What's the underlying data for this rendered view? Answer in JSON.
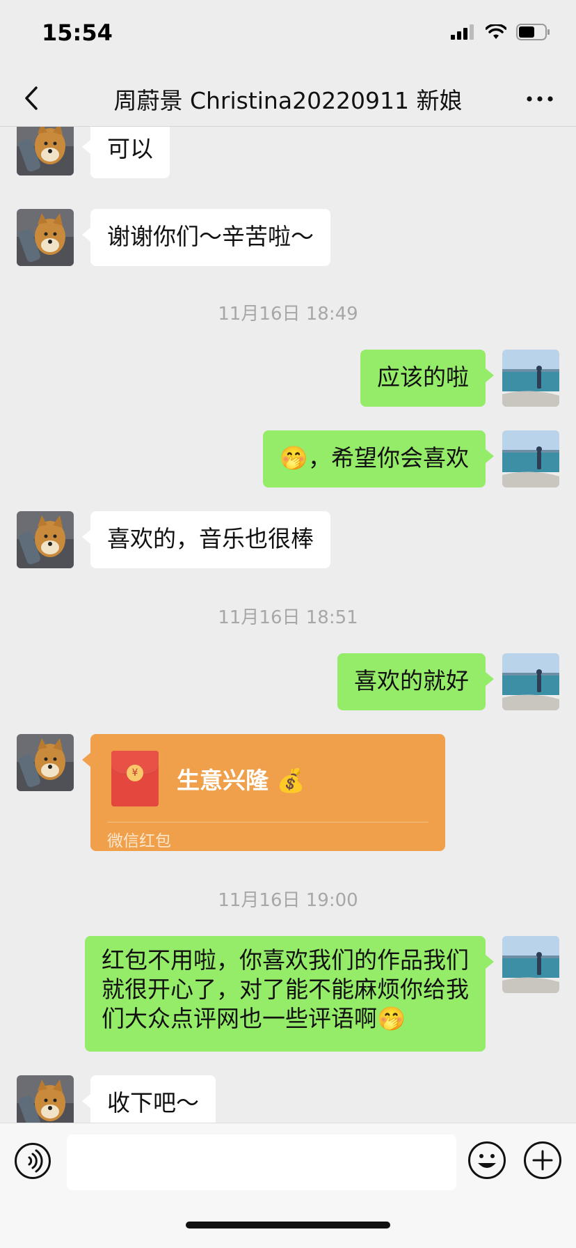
{
  "status": {
    "time": "15:54"
  },
  "nav": {
    "title": "周蔚景 Christina20220911 新娘"
  },
  "messages": [
    {
      "type": "incoming",
      "text": "可以"
    },
    {
      "type": "incoming",
      "text": "谢谢你们～辛苦啦～"
    },
    {
      "type": "timestamp",
      "text": "11月16日 18:49"
    },
    {
      "type": "outgoing",
      "text": "应该的啦"
    },
    {
      "type": "outgoing",
      "emoji": "🤭",
      "text": "，希望你会喜欢"
    },
    {
      "type": "incoming",
      "text": "喜欢的，音乐也很棒"
    },
    {
      "type": "timestamp",
      "text": "11月16日 18:51"
    },
    {
      "type": "outgoing",
      "text": "喜欢的就好"
    },
    {
      "type": "red_packet",
      "title": "生意兴隆",
      "emoji": "💰",
      "caption": "微信红包"
    },
    {
      "type": "timestamp",
      "text": "11月16日 19:00"
    },
    {
      "type": "outgoing",
      "text": "红包不用啦，你喜欢我们的作品我们就很开心了，对了能不能麻烦你给我们大众点评网也一些评语啊",
      "emoji": "🤭"
    },
    {
      "type": "incoming",
      "text": "收下吧～"
    }
  ],
  "input": {
    "value": ""
  },
  "colors": {
    "background": "#ededed",
    "outgoing_bubble": "#95ec69",
    "incoming_bubble": "#ffffff",
    "red_packet": "#f0a04b",
    "timestamp": "#a7a7a7"
  },
  "icons": [
    "back-arrow-icon",
    "more-icon",
    "voice-icon",
    "emoji-icon",
    "plus-icon",
    "signal-icon",
    "wifi-icon",
    "battery-icon"
  ]
}
